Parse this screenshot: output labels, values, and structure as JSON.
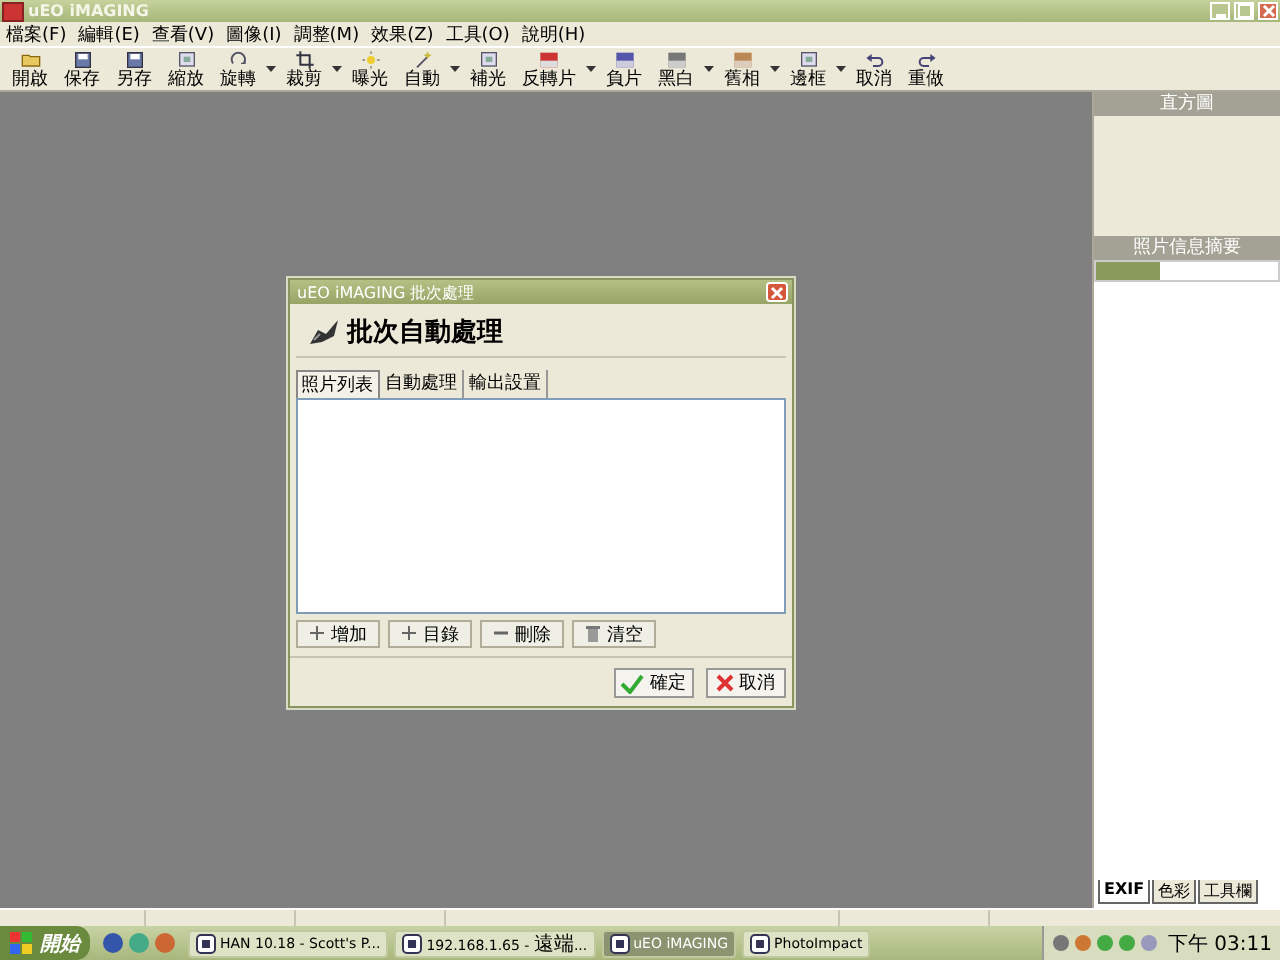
{
  "window": {
    "title": "uEO iMAGING"
  },
  "menu": [
    "檔案(F)",
    "編輯(E)",
    "查看(V)",
    "圖像(I)",
    "調整(M)",
    "效果(Z)",
    "工具(O)",
    "說明(H)"
  ],
  "toolbar": [
    {
      "kind": "button",
      "label": "開啟"
    },
    {
      "kind": "button",
      "label": "保存"
    },
    {
      "kind": "button",
      "label": "另存"
    },
    {
      "kind": "button",
      "label": "縮放"
    },
    {
      "kind": "button",
      "label": "旋轉"
    },
    {
      "kind": "arrow"
    },
    {
      "kind": "button",
      "label": "裁剪"
    },
    {
      "kind": "arrow"
    },
    {
      "kind": "button",
      "label": "曝光"
    },
    {
      "kind": "button",
      "label": "自動"
    },
    {
      "kind": "arrow"
    },
    {
      "kind": "button",
      "label": "補光"
    },
    {
      "kind": "button",
      "label": "反轉片"
    },
    {
      "kind": "arrow"
    },
    {
      "kind": "button",
      "label": "負片"
    },
    {
      "kind": "button",
      "label": "黑白"
    },
    {
      "kind": "arrow"
    },
    {
      "kind": "button",
      "label": "舊相"
    },
    {
      "kind": "arrow"
    },
    {
      "kind": "button",
      "label": "邊框"
    },
    {
      "kind": "arrow"
    },
    {
      "kind": "button",
      "label": "取消"
    },
    {
      "kind": "button",
      "label": "重做"
    }
  ],
  "dialog": {
    "title": "uEO iMAGING 批次處理",
    "heading": "批次自動處理",
    "tabs": [
      {
        "label": "照片列表",
        "selected": true
      },
      {
        "label": "自動處理",
        "selected": false
      },
      {
        "label": "輸出設置",
        "selected": false
      }
    ],
    "list_buttons": [
      "增加",
      "目錄",
      "刪除",
      "清空"
    ],
    "buttons": [
      "確定",
      "取消"
    ]
  },
  "side_panel": {
    "histogram_title": "直方圖",
    "info_title": "照片信息摘要",
    "info_bar": {
      "level": 0.35
    },
    "tabs": [
      {
        "label": "EXIF",
        "selected": true
      },
      {
        "label": "色彩",
        "selected": false
      },
      {
        "label": "工具欄",
        "selected": false
      }
    ]
  },
  "taskbar": {
    "start": "開始",
    "tasks": [
      {
        "label": "HAN 10.18 - Scott's P...",
        "selected": false
      },
      {
        "label": "192.168.1.65 - 遠端...",
        "selected": false
      },
      {
        "label": "uEO iMAGING",
        "selected": true
      },
      {
        "label": "PhotoImpact",
        "selected": false
      }
    ],
    "clock": "下午 03:11"
  }
}
